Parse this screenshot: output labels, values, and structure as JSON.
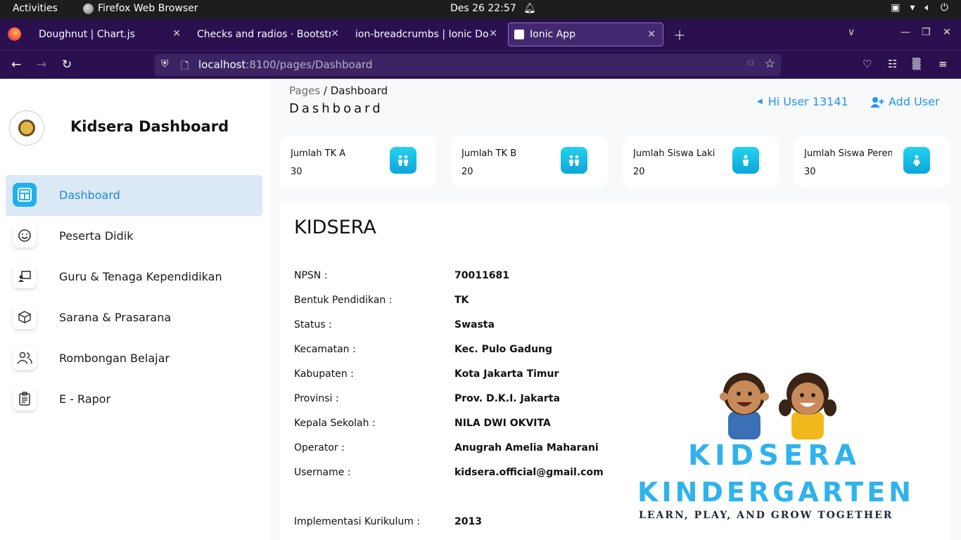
{
  "system": {
    "activities": "Activities",
    "app_name": "Firefox Web Browser",
    "clock": "Des 26  22:57"
  },
  "browser": {
    "tabs": [
      {
        "title": "Doughnut | Chart.js",
        "active": false
      },
      {
        "title": "Checks and radios · Bootstra",
        "active": false
      },
      {
        "title": "ion-breadcrumbs | Ionic Docu",
        "active": false
      },
      {
        "title": "Ionic App",
        "active": true
      }
    ],
    "url_host": "localhost",
    "url_path": ":8100/pages/Dashboard"
  },
  "sidebar": {
    "brand_title": "Kidsera Dashboard",
    "items": [
      {
        "label": "Dashboard",
        "icon": "dashboard-icon",
        "active": true
      },
      {
        "label": "Peserta Didik",
        "icon": "smile-icon",
        "active": false
      },
      {
        "label": "Guru & Tenaga Kependidikan",
        "icon": "teacher-icon",
        "active": false
      },
      {
        "label": "Sarana & Prasarana",
        "icon": "cube-icon",
        "active": false
      },
      {
        "label": "Rombongan Belajar",
        "icon": "people-icon",
        "active": false
      },
      {
        "label": "E - Rapor",
        "icon": "clipboard-icon",
        "active": false
      }
    ]
  },
  "header": {
    "breadcrumb_root": "Pages",
    "breadcrumb_sep": " / ",
    "breadcrumb_current": "Dashboard",
    "title": "Dashboard",
    "hi_user": "Hi User 13141",
    "add_user": "Add User"
  },
  "stats": [
    {
      "label": "Jumlah TK A",
      "value": "30",
      "icon": "children-icon"
    },
    {
      "label": "Jumlah TK B",
      "value": "20",
      "icon": "children-icon"
    },
    {
      "label": "Jumlah Siswa Laki",
      "value": "20",
      "icon": "boy-icon"
    },
    {
      "label": "Jumlah Siswa Perempuan",
      "value": "30",
      "icon": "girl-icon"
    }
  ],
  "school": {
    "title": "KIDSERA",
    "fields": [
      {
        "key": "NPSN :",
        "value": "70011681"
      },
      {
        "key": "Bentuk Pendidikan :",
        "value": "TK"
      },
      {
        "key": "Status :",
        "value": "Swasta"
      },
      {
        "key": "Kecamatan :",
        "value": "Kec. Pulo Gadung"
      },
      {
        "key": "Kabupaten :",
        "value": "Kota Jakarta Timur"
      },
      {
        "key": "Provinsi :",
        "value": "Prov. D.K.I. Jakarta"
      },
      {
        "key": "Kepala Sekolah :",
        "value": "NILA DWI OKVITA"
      },
      {
        "key": "Operator :",
        "value": "Anugrah Amelia Maharani"
      },
      {
        "key": "Username :",
        "value": "kidsera.official@gmail.com"
      },
      {
        "key": "Implementasi Kurikulum :",
        "value": "2013"
      }
    ],
    "logo_word1": "KIDSERA",
    "logo_word2": "KINDERGARTEN",
    "logo_tagline": "LEARN, PLAY, AND GROW TOGETHER"
  },
  "colors": {
    "accent": "#2196f3",
    "sidebar_active_bg": "#dbe8f6",
    "logo_blue": "#2fb3ec",
    "browser_bg": "#2b1050"
  }
}
